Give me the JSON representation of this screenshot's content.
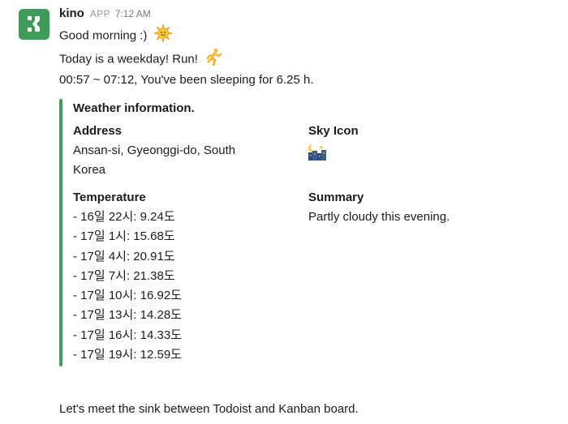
{
  "message": {
    "sender": "kino",
    "badge": "APP",
    "time": "7:12 AM",
    "lines": [
      "Good morning :)",
      "Today is a weekday! Run!",
      "00:57 ~ 07:12, You've been sleeping for 6.25 h."
    ],
    "icons": [
      "sun-face-icon",
      "runner-icon",
      "night-city-icon"
    ],
    "accent_color": "#3f9b59"
  },
  "attachment": {
    "title": "Weather information.",
    "address_label": "Address",
    "address_value_line1": "Ansan-si, Gyeonggi-do, South",
    "address_value_line2": "Korea",
    "sky_icon_label": "Sky Icon",
    "temperature_label": "Temperature",
    "temperature_items": [
      "- 16일 22시: 9.24도",
      "- 17일 1시: 15.68도",
      "- 17일 4시: 20.91도",
      "- 17일 7시: 21.38도",
      "- 17일 10시: 16.92도",
      "- 17일 13시: 14.28도",
      "- 17일 16시: 14.33도",
      "- 17일 19시: 12.59도"
    ],
    "summary_label": "Summary",
    "summary_value": "Partly cloudy this evening."
  },
  "footer_text": "Let's meet the sink between Todoist and Kanban board."
}
